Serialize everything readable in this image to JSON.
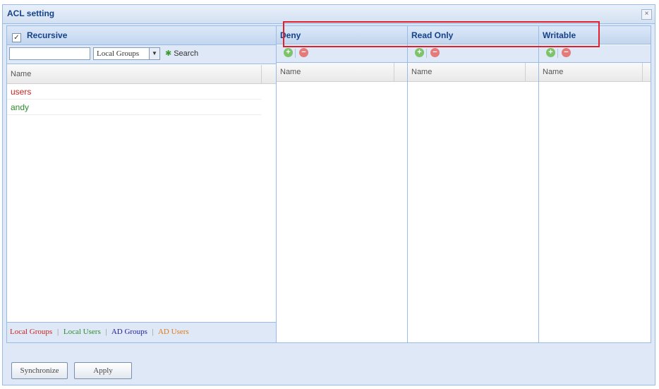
{
  "window": {
    "title": "ACL setting",
    "close_label": "×"
  },
  "left": {
    "recursive_label": "Recursive",
    "recursive_checked": "✓",
    "search_value": "",
    "filter_selected": "Local Groups",
    "search_label": "Search",
    "column_header": "Name",
    "rows": [
      {
        "name": "users",
        "color": "#cc2222"
      },
      {
        "name": "andy",
        "color": "#2e8b2e"
      }
    ],
    "legend": [
      {
        "label": "Local Groups",
        "color": "#cc2222"
      },
      {
        "label": "Local Users",
        "color": "#2e8b2e"
      },
      {
        "label": "AD Groups",
        "color": "#22229a"
      },
      {
        "label": "AD Users",
        "color": "#e07a1a"
      }
    ],
    "legend_sep": "|"
  },
  "panels": [
    {
      "title": "Deny",
      "column_header": "Name"
    },
    {
      "title": "Read Only",
      "column_header": "Name"
    },
    {
      "title": "Writable",
      "column_header": "Name"
    }
  ],
  "buttons": {
    "synchronize": "Synchronize",
    "apply": "Apply"
  },
  "colors": {
    "highlight_box": "#e0202a",
    "header_text": "#15428b"
  }
}
